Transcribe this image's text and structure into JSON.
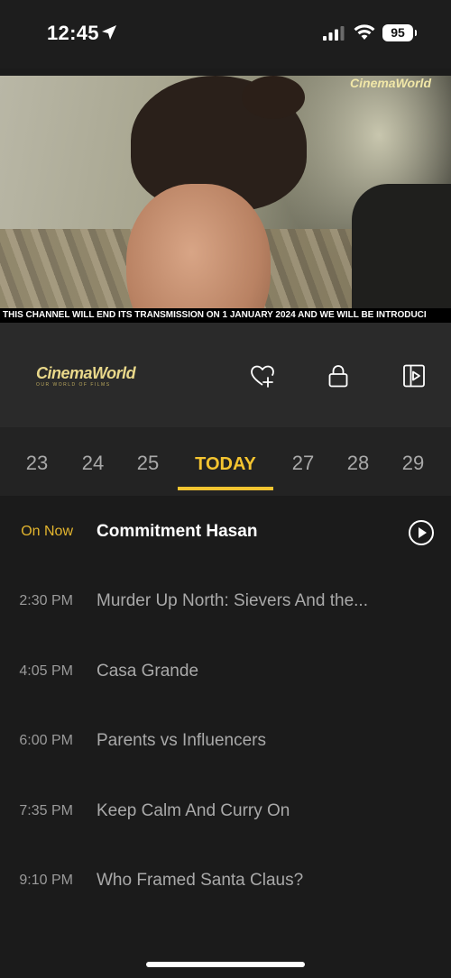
{
  "status_bar": {
    "time": "12:45",
    "battery": "95"
  },
  "player": {
    "watermark": "CinemaWorld",
    "ticker": "THIS CHANNEL WILL END ITS TRANSMISSION ON 1 JANUARY 2024 AND WE WILL BE INTRODUCI"
  },
  "channel": {
    "logo_text": "CinemaWorld",
    "logo_subtitle": "OUR WORLD OF FILMS",
    "controls": [
      "heart-plus-icon",
      "lock-icon",
      "picture-in-picture-icon"
    ]
  },
  "date_tabs": {
    "items": [
      "23",
      "24",
      "25",
      "TODAY",
      "27",
      "28",
      "29"
    ],
    "selected": "TODAY"
  },
  "schedule": [
    {
      "time": "On Now",
      "title": "Commitment Hasan"
    },
    {
      "time": "2:30 PM",
      "title": "Murder Up North: Sievers And the..."
    },
    {
      "time": "4:05 PM",
      "title": "Casa Grande"
    },
    {
      "time": "6:00 PM",
      "title": "Parents vs Influencers"
    },
    {
      "time": "7:35 PM",
      "title": "Keep Calm And Curry On"
    },
    {
      "time": "9:10 PM",
      "title": "Who Framed Santa Claus?"
    }
  ],
  "colors": {
    "accent": "#f4c430",
    "background": "#1b1b1b",
    "control_bar": "#2a2a2a"
  }
}
